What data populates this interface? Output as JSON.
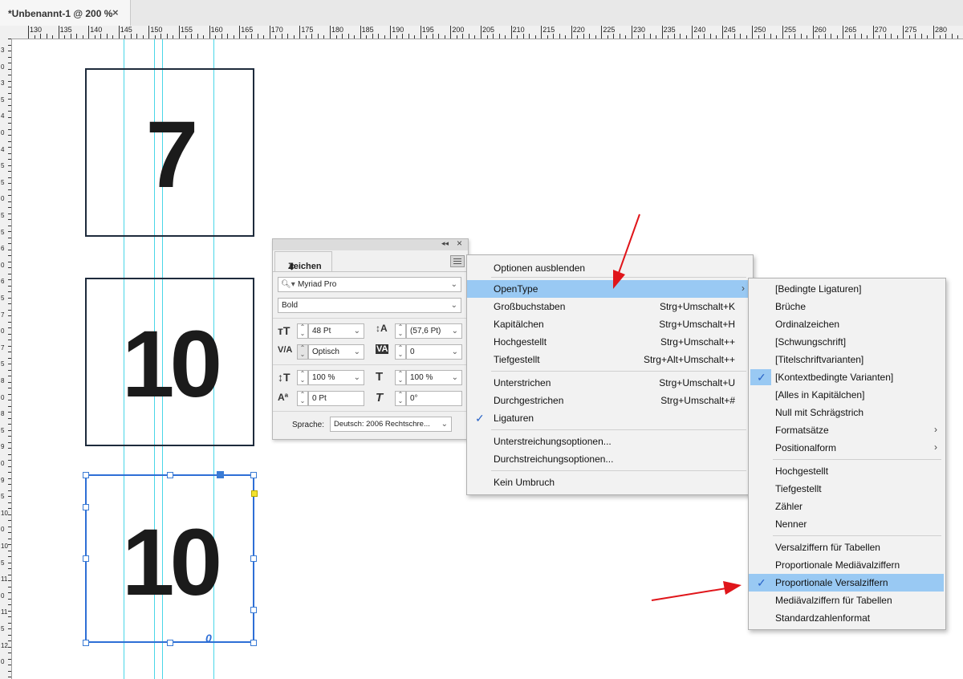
{
  "tab": {
    "title": "*Unbenannt-1 @ 200 %",
    "close": "×"
  },
  "ruler": {
    "h_labels": [
      "130",
      "135",
      "140",
      "145",
      "150",
      "155",
      "160",
      "165",
      "170",
      "175",
      "180",
      "185",
      "190",
      "195",
      "200",
      "205",
      "210",
      "215",
      "220",
      "225",
      "230",
      "235",
      "240",
      "245",
      "250",
      "255",
      "260",
      "265",
      "270",
      "275",
      "280"
    ],
    "v_labels": [
      "3",
      "0",
      "3",
      "5",
      "4",
      "0",
      "4",
      "5",
      "5",
      "0",
      "5",
      "5",
      "6",
      "0",
      "6",
      "5",
      "7",
      "0",
      "7",
      "5",
      "8",
      "0",
      "8",
      "5",
      "9",
      "0",
      "9",
      "5",
      "10",
      "0",
      "10",
      "5",
      "11",
      "0",
      "11",
      "5",
      "12",
      "0"
    ]
  },
  "canvas": {
    "frames": [
      "7",
      "10",
      "10"
    ],
    "overset_glyph": "0"
  },
  "panel": {
    "collapse": "◂◂",
    "close": "×",
    "title": "Zeichen",
    "font": "Myriad Pro",
    "style": "Bold",
    "size": "48 Pt",
    "leading": "(57,6 Pt)",
    "kerning": "Optisch",
    "tracking": "0",
    "vscale": "100 %",
    "hscale": "100 %",
    "baseline": "0 Pt",
    "skew": "0°",
    "lang_label": "Sprache:",
    "lang_value": "Deutsch: 2006 Rechtschre..."
  },
  "menu": {
    "items": [
      {
        "label": "Optionen ausblenden",
        "shortcut": ""
      },
      {
        "label": "OpenType",
        "shortcut": ""
      },
      {
        "label": "Großbuchstaben",
        "shortcut": "Strg+Umschalt+K"
      },
      {
        "label": "Kapitälchen",
        "shortcut": "Strg+Umschalt+H"
      },
      {
        "label": "Hochgestellt",
        "shortcut": "Strg+Umschalt++"
      },
      {
        "label": "Tiefgestellt",
        "shortcut": "Strg+Alt+Umschalt++"
      },
      {
        "label": "Unterstrichen",
        "shortcut": "Strg+Umschalt+U"
      },
      {
        "label": "Durchgestrichen",
        "shortcut": "Strg+Umschalt+#"
      },
      {
        "label": "Ligaturen",
        "shortcut": "",
        "checked": true
      },
      {
        "label": "Unterstreichungsoptionen...",
        "shortcut": ""
      },
      {
        "label": "Durchstreichungsoptionen...",
        "shortcut": ""
      },
      {
        "label": "Kein Umbruch",
        "shortcut": ""
      }
    ]
  },
  "submenu": {
    "items": [
      {
        "label": "[Bedingte Ligaturen]"
      },
      {
        "label": "Brüche"
      },
      {
        "label": "Ordinalzeichen"
      },
      {
        "label": "[Schwungschrift]"
      },
      {
        "label": "[Titelschriftvarianten]"
      },
      {
        "label": "[Kontextbedingte Varianten]",
        "checked": true
      },
      {
        "label": "[Alles in Kapitälchen]"
      },
      {
        "label": "Null mit Schrägstrich"
      },
      {
        "label": "Formatsätze"
      },
      {
        "label": "Positionalform"
      },
      {
        "label": "Hochgestellt"
      },
      {
        "label": "Tiefgestellt"
      },
      {
        "label": "Zähler"
      },
      {
        "label": "Nenner"
      },
      {
        "label": "Versalziffern für Tabellen"
      },
      {
        "label": "Proportionale Mediävalziffern"
      },
      {
        "label": "Proportionale Versalziffern",
        "checked": true
      },
      {
        "label": "Mediävalziffern für Tabellen"
      },
      {
        "label": "Standardzahlenformat"
      }
    ]
  },
  "colors": {
    "highlight": "#99c9f3",
    "guide": "#49d6e8",
    "arrow": "#e0151a"
  }
}
